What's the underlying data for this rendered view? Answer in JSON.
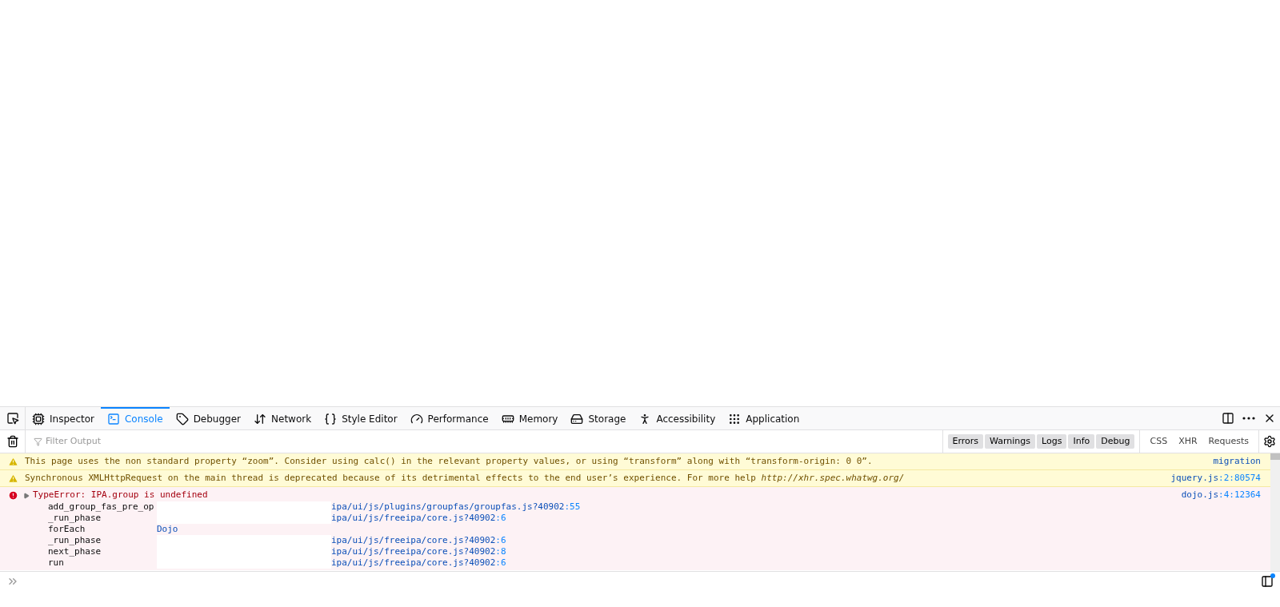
{
  "toolbox": {
    "tabs": [
      {
        "label": "Inspector",
        "selected": false
      },
      {
        "label": "Console",
        "selected": true
      },
      {
        "label": "Debugger",
        "selected": false
      },
      {
        "label": "Network",
        "selected": false
      },
      {
        "label": "Style Editor",
        "selected": false
      },
      {
        "label": "Performance",
        "selected": false
      },
      {
        "label": "Memory",
        "selected": false
      },
      {
        "label": "Storage",
        "selected": false
      },
      {
        "label": "Accessibility",
        "selected": false
      },
      {
        "label": "Application",
        "selected": false
      }
    ]
  },
  "filter_bar": {
    "placeholder": "Filter Output",
    "levels": [
      {
        "label": "Errors",
        "selected": true
      },
      {
        "label": "Warnings",
        "selected": true
      },
      {
        "label": "Logs",
        "selected": true
      },
      {
        "label": "Info",
        "selected": true
      },
      {
        "label": "Debug",
        "selected": true
      }
    ],
    "categories": [
      {
        "label": "CSS",
        "selected": false
      },
      {
        "label": "XHR",
        "selected": false
      },
      {
        "label": "Requests",
        "selected": false
      }
    ]
  },
  "messages": [
    {
      "kind": "warning",
      "text": "This page uses the non standard property “zoom”. Consider using calc() in the relevant property values, or using “transform” along with “transform-origin: 0 0”.",
      "source_file": "migration"
    },
    {
      "kind": "warning",
      "text": "Synchronous XMLHttpRequest on the main thread is deprecated because of its detrimental effects to the end user’s experience. For more help *http://xhr.spec.whatwg.org/*",
      "source_file": "jquery.js",
      "source_loc": ":2:80574"
    },
    {
      "kind": "error",
      "text": "TypeError: IPA.group is undefined",
      "expanded": false,
      "source_file": "dojo.js",
      "source_loc": ":4:12364",
      "stack": [
        {
          "fn": "add_group_fas_pre_op",
          "url": "ipa/ui/js/plugins/groupfas/groupfas.js?40902",
          "loc": ":55"
        },
        {
          "fn": "_run_phase",
          "url": "ipa/ui/js/freeipa/core.js?40902",
          "loc": ":6"
        },
        {
          "fn": "forEach",
          "library": "Dojo"
        },
        {
          "fn": "_run_phase",
          "url": "ipa/ui/js/freeipa/core.js?40902",
          "loc": ":6"
        },
        {
          "fn": "next_phase",
          "url": "ipa/ui/js/freeipa/core.js?40902",
          "loc": ":8"
        },
        {
          "fn": "run",
          "url": "ipa/ui/js/freeipa/core.js?40902",
          "loc": ":6"
        }
      ]
    }
  ]
}
